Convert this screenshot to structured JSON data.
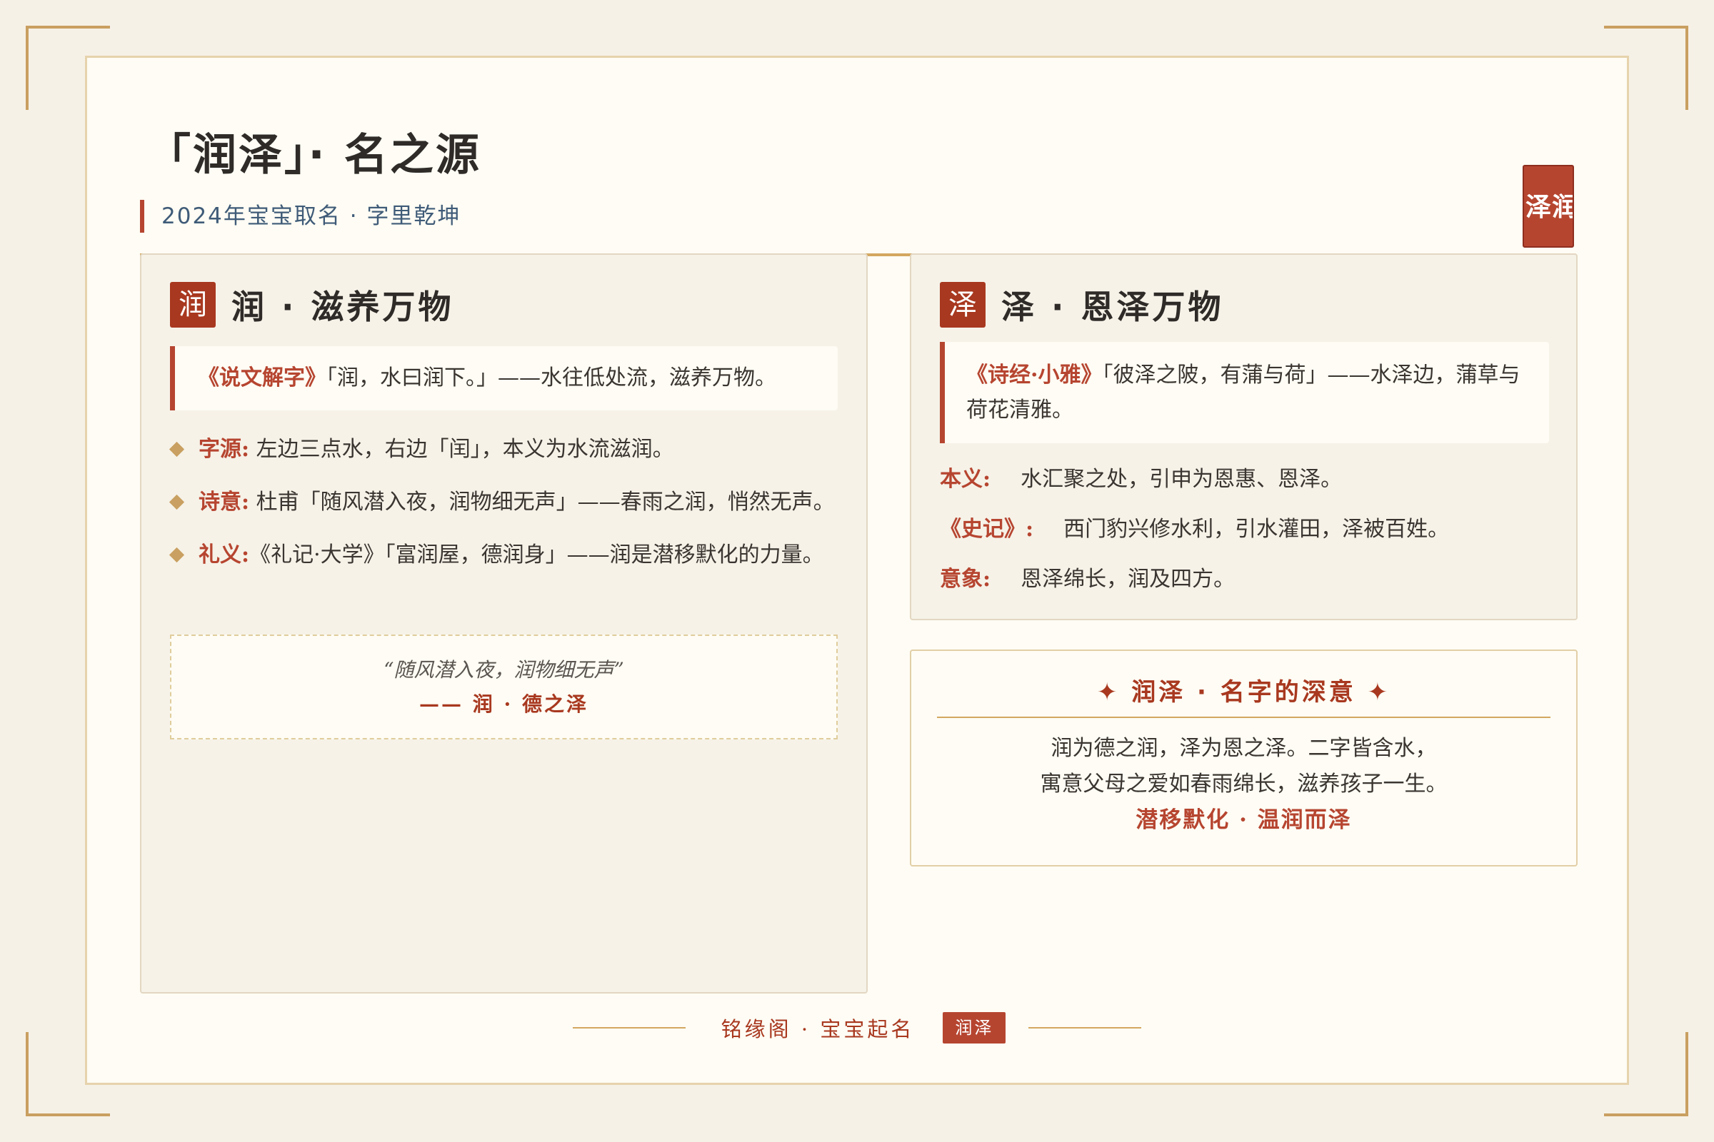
{
  "header": {
    "title": "「润泽」· 名之源",
    "subtitle": "2024年宝宝取名 · 字里乾坤",
    "seal": "泽润"
  },
  "run": {
    "badge": "润",
    "title": "润 · 滋养万物",
    "quote_source": "《说文解字》",
    "quote_text": "「润，水曰润下。」——水往低处流，滋养万物。",
    "items": [
      {
        "label": "字源:",
        "text": " 左边三点水，右边「闰」，本义为水流滋润。"
      },
      {
        "label": "诗意:",
        "text": " 杜甫「随风潜入夜，润物细无声」——春雨之润，悄然无声。"
      },
      {
        "label": "礼义:",
        "text": "《礼记·大学》「富润屋，德润身」——润是潜移默化的力量。"
      }
    ],
    "poem_line": "“随风潜入夜，润物细无声”",
    "poem_sig": "—— 润 · 德之泽"
  },
  "ze": {
    "badge": "泽",
    "title": "泽 · 恩泽万物",
    "quote_source": "《诗经·小雅》",
    "quote_text": "「彼泽之陂，有蒲与荷」——水泽边，蒲草与荷花清雅。",
    "defs": [
      {
        "label": "本义:",
        "text": "水汇聚之处，引申为恩惠、恩泽。"
      },
      {
        "label": "《史记》:",
        "text": "西门豹兴修水利，引水灌田，泽被百姓。"
      },
      {
        "label": "意象:",
        "text": "恩泽绵长，润及四方。"
      }
    ]
  },
  "meaning": {
    "title": "✦ 润泽 · 名字的深意 ✦",
    "line1": "润为德之润，泽为恩之泽。二字皆含水，",
    "line2": "寓意父母之爱如春雨绵长，滋养孩子一生。",
    "tagline": "潜移默化 · 温润而泽"
  },
  "footer": {
    "text": "铭缘阁 · 宝宝起名",
    "badge": "润泽"
  },
  "colors": {
    "accent": "#b64530",
    "gold": "#c9a061",
    "background": "#f6f1e7",
    "card": "#fefcf4"
  }
}
